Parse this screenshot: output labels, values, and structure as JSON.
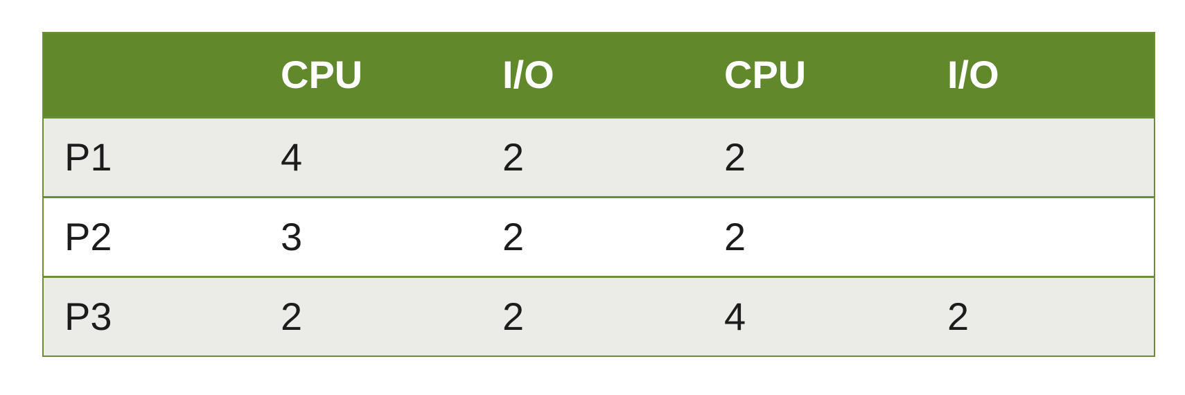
{
  "table": {
    "headers": [
      "",
      "CPU",
      "I/O",
      "CPU",
      "I/O"
    ],
    "rows": [
      {
        "label": "P1",
        "cells": [
          "4",
          "2",
          "2",
          ""
        ]
      },
      {
        "label": "P2",
        "cells": [
          "3",
          "2",
          "2",
          ""
        ]
      },
      {
        "label": "P3",
        "cells": [
          "2",
          "2",
          "4",
          "2"
        ]
      }
    ]
  },
  "colors": {
    "header_bg": "#62882c",
    "header_text": "#ffffff",
    "border": "#6a8e35",
    "row_odd_bg": "#ebebe8",
    "row_even_bg": "#ffffff"
  }
}
